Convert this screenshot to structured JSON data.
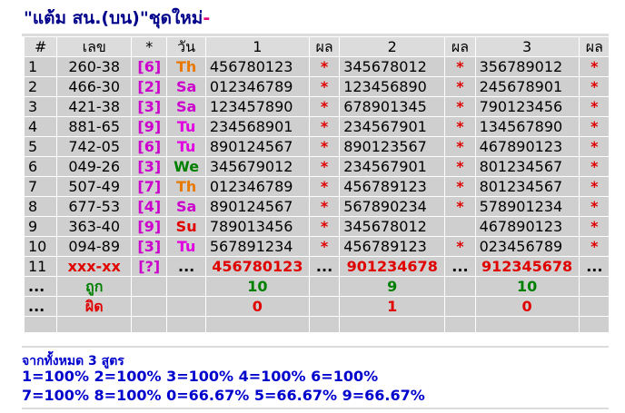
{
  "title": "\"แต้ม สน.(บน)\"ชุดใหม่",
  "title_mark": "-",
  "headers": [
    "#",
    "เลข",
    "*",
    "วัน",
    "1",
    "ผล",
    "2",
    "ผล",
    "3",
    "ผล"
  ],
  "day_colors": {
    "Th": "#e87800",
    "Sa": "#cc00cc",
    "Tu": "#e000e0",
    "We": "#008000",
    "Su": "#e00000"
  },
  "rows": [
    {
      "n": "1",
      "code": "260-38",
      "br": "[6]",
      "day": "Th",
      "c1": "456780123",
      "r1": "*",
      "c2": "345678012",
      "r2": "*",
      "c3": "356789012",
      "r3": "*"
    },
    {
      "n": "2",
      "code": "466-30",
      "br": "[2]",
      "day": "Sa",
      "c1": "012346789",
      "r1": "*",
      "c2": "123456890",
      "r2": "*",
      "c3": "245678901",
      "r3": "*"
    },
    {
      "n": "3",
      "code": "421-38",
      "br": "[3]",
      "day": "Sa",
      "c1": "123457890",
      "r1": "*",
      "c2": "678901345",
      "r2": "*",
      "c3": "790123456",
      "r3": "*"
    },
    {
      "n": "4",
      "code": "881-65",
      "br": "[9]",
      "day": "Tu",
      "c1": "234568901",
      "r1": "*",
      "c2": "234567901",
      "r2": "*",
      "c3": "134567890",
      "r3": "*"
    },
    {
      "n": "5",
      "code": "742-05",
      "br": "[6]",
      "day": "Tu",
      "c1": "890124567",
      "r1": "*",
      "c2": "890123567",
      "r2": "*",
      "c3": "467890123",
      "r3": "*"
    },
    {
      "n": "6",
      "code": "049-26",
      "br": "[3]",
      "day": "We",
      "c1": "345679012",
      "r1": "*",
      "c2": "234567901",
      "r2": "*",
      "c3": "801234567",
      "r3": "*"
    },
    {
      "n": "7",
      "code": "507-49",
      "br": "[7]",
      "day": "Th",
      "c1": "012346789",
      "r1": "*",
      "c2": "456789123",
      "r2": "*",
      "c3": "801234567",
      "r3": "*"
    },
    {
      "n": "8",
      "code": "677-53",
      "br": "[4]",
      "day": "Sa",
      "c1": "890124567",
      "r1": "*",
      "c2": "567890234",
      "r2": "*",
      "c3": "578901234",
      "r3": "*"
    },
    {
      "n": "9",
      "code": "363-40",
      "br": "[9]",
      "day": "Su",
      "c1": "789013456",
      "r1": "*",
      "c2": "345678012",
      "r2": "",
      "c3": "467890123",
      "r3": "*"
    },
    {
      "n": "10",
      "code": "094-89",
      "br": "[3]",
      "day": "Tu",
      "c1": "567891234",
      "r1": "*",
      "c2": "456789123",
      "r2": "*",
      "c3": "023456789",
      "r3": "*"
    }
  ],
  "prediction": {
    "n": "11",
    "code": "xxx-xx",
    "br": "[?]",
    "day": "...",
    "c1": "456780123",
    "r1": "...",
    "c2": "901234678",
    "r2": "...",
    "c3": "912345678",
    "r3": "..."
  },
  "correct": {
    "n": "...",
    "label": "ถูก",
    "v1": "10",
    "v2": "9",
    "v3": "10"
  },
  "wrong": {
    "n": "...",
    "label": "ผิด",
    "v1": "0",
    "v2": "1",
    "v3": "0"
  },
  "summary": {
    "line1": "จากทั้งหมด 3 สูตร",
    "line2": "1=100% 2=100% 3=100% 4=100% 6=100%",
    "line3": "7=100% 8=100% 0=66.67% 5=66.67% 9=66.67%"
  }
}
